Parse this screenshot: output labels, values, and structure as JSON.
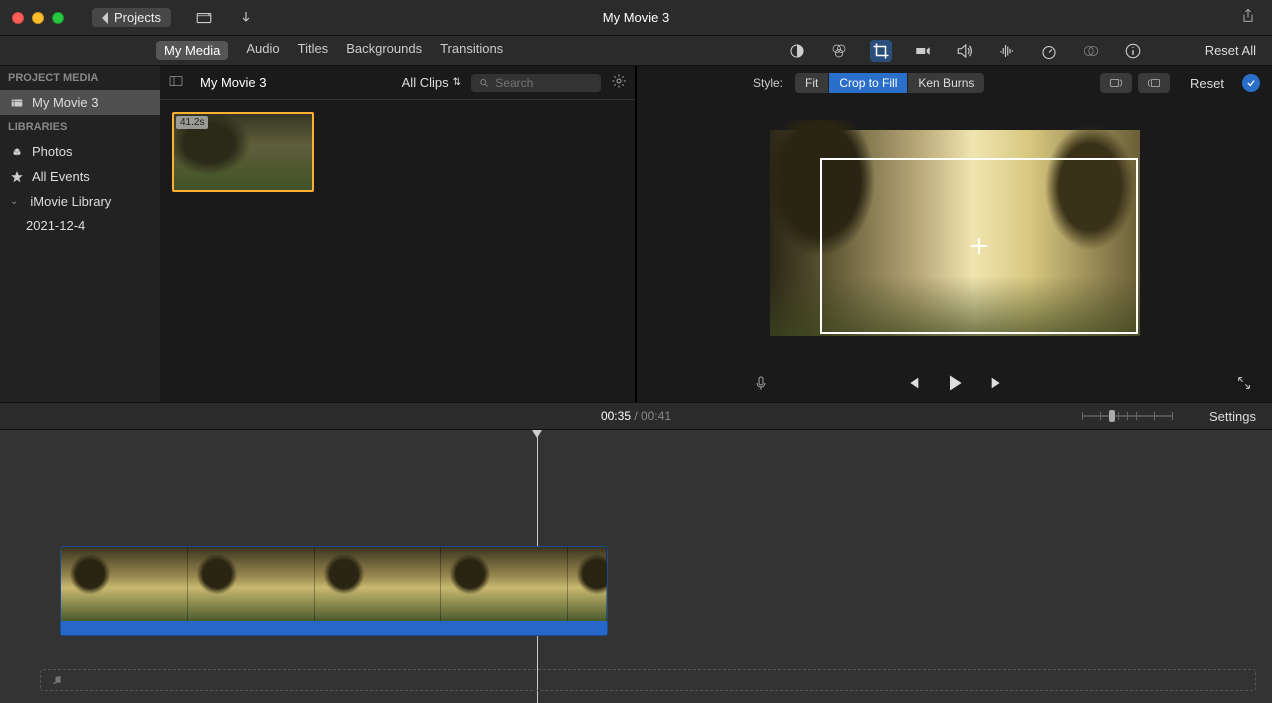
{
  "titlebar": {
    "back_label": "Projects",
    "title": "My Movie 3"
  },
  "tabs": [
    "My Media",
    "Audio",
    "Titles",
    "Backgrounds",
    "Transitions"
  ],
  "reset_all": "Reset All",
  "sidebar": {
    "section_project": "PROJECT MEDIA",
    "project_name": "My Movie 3",
    "section_libraries": "LIBRARIES",
    "photos": "Photos",
    "all_events": "All Events",
    "library": "iMovie Library",
    "event": "2021-12-4"
  },
  "browser": {
    "event_title": "My Movie 3",
    "dropdown": "All Clips",
    "search_placeholder": "Search",
    "thumb_duration": "41.2s"
  },
  "style": {
    "label": "Style:",
    "fit": "Fit",
    "crop": "Crop to Fill",
    "kenburns": "Ken Burns",
    "reset": "Reset"
  },
  "timeline": {
    "current": "00:35",
    "sep": " / ",
    "total": "00:41",
    "settings": "Settings"
  }
}
